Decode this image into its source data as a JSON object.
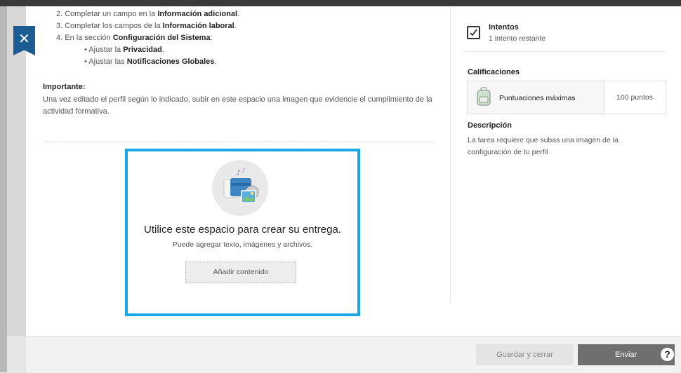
{
  "instructions": {
    "items": [
      {
        "pre": "2. Completar un campo en la ",
        "bold": "Información adicional",
        "post": "."
      },
      {
        "pre": "3. Completar los campos de la ",
        "bold": "Información laboral",
        "post": "."
      },
      {
        "pre": "4. En la sección ",
        "bold": "Configuración del Sistema",
        "post": ":"
      }
    ],
    "subitems": [
      {
        "pre": "• Ajustar la ",
        "bold": "Privacidad",
        "post": "."
      },
      {
        "pre": "• Ajustar las ",
        "bold": "Notificaciones Globales",
        "post": "."
      }
    ],
    "important_title": "Importante:",
    "important_text": "Una vez editado el perfil según lo indicado, subir en este espacio una imagen que evidencie el cumplimiento de la actividad formativa."
  },
  "dropzone": {
    "title": "Utilice este espacio para crear su entrega.",
    "subtitle": "Puede agregar texto, imágenes y archivos.",
    "add_button": "Añadir contenido"
  },
  "sidebar": {
    "attempts_title": "Intentos",
    "attempts_value": "1 intento restante",
    "grades_title": "Calificaciones",
    "grades_label": "Puntuaciones máximas",
    "grades_value": "100 puntos",
    "description_title": "Descripción",
    "description_text": "La tarea requiere que subas una imagen de la configuración de tu perfil"
  },
  "footer": {
    "save_label": "Guardar y cerrar",
    "send_label": "Enviar",
    "help_symbol": "?"
  },
  "close_symbol": "✕",
  "colors": {
    "accent": "#1aa7e6",
    "close_tab": "#1b5d92",
    "send_button": "#6f6f6f"
  }
}
